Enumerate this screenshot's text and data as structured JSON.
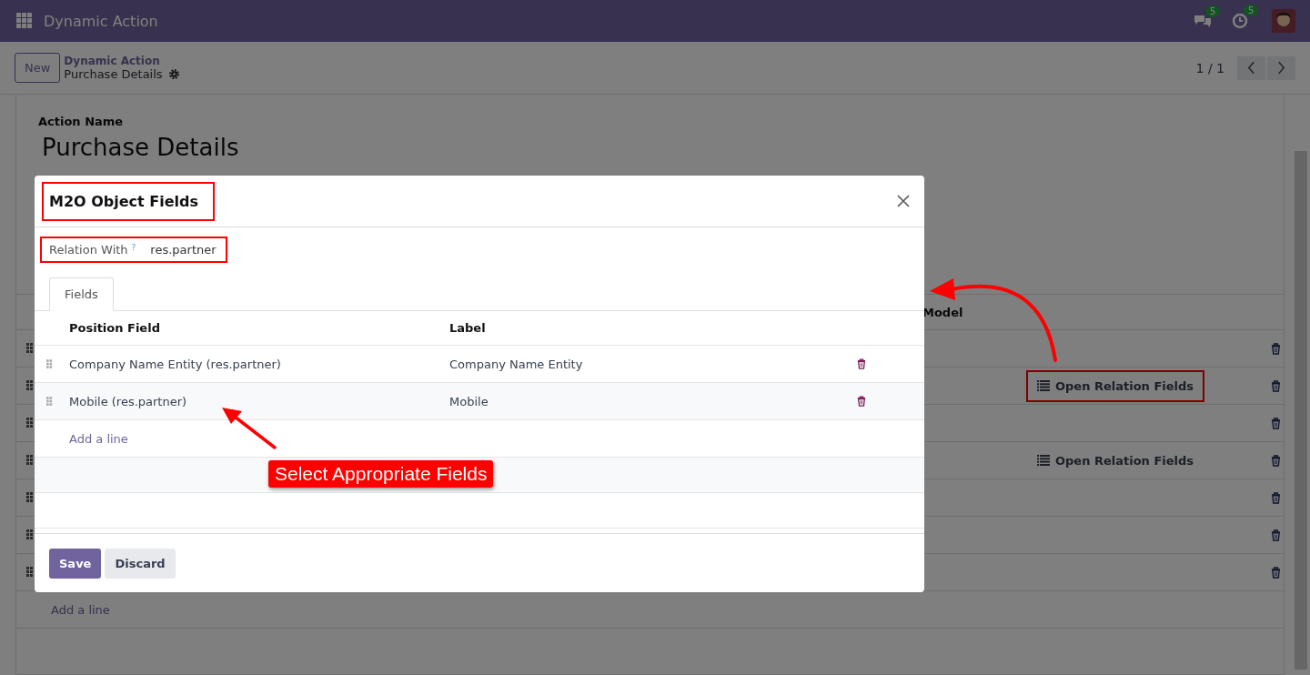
{
  "navbar": {
    "app_name": "Dynamic Action",
    "messages_badge": "5",
    "activities_badge": "5"
  },
  "control_panel": {
    "new_button": "New",
    "breadcrumb": "Dynamic Action",
    "record": "Purchase Details",
    "pager": "1 / 1"
  },
  "form": {
    "field_label": "Action Name",
    "title": "Purchase Details",
    "visible_column": "Model",
    "add_line": "Add a line",
    "rows": [
      {
        "kind": "plain"
      },
      {
        "kind": "relation",
        "button": "Open Relation Fields",
        "annotated": true
      },
      {
        "kind": "plain"
      },
      {
        "kind": "relation",
        "button": "Open Relation Fields",
        "annotated": false
      },
      {
        "kind": "plain"
      },
      {
        "kind": "plain"
      },
      {
        "kind": "plain"
      }
    ]
  },
  "modal": {
    "title": "M2O Object Fields",
    "relation_label": "Relation With",
    "help_mark": "?",
    "relation_value": "res.partner",
    "tabs": [
      {
        "label": "Fields",
        "selected": true
      }
    ],
    "columns": [
      "Position Field",
      "Label"
    ],
    "rows": [
      {
        "position_field": "Company Name Entity (res.partner)",
        "label": "Company Name Entity"
      },
      {
        "position_field": "Mobile (res.partner)",
        "label": "Mobile"
      }
    ],
    "add_line": "Add a line",
    "buttons": [
      {
        "label": "Save",
        "kind": "primary"
      },
      {
        "label": "Discard",
        "kind": "secondary"
      }
    ]
  },
  "callout": "Select Appropriate Fields"
}
